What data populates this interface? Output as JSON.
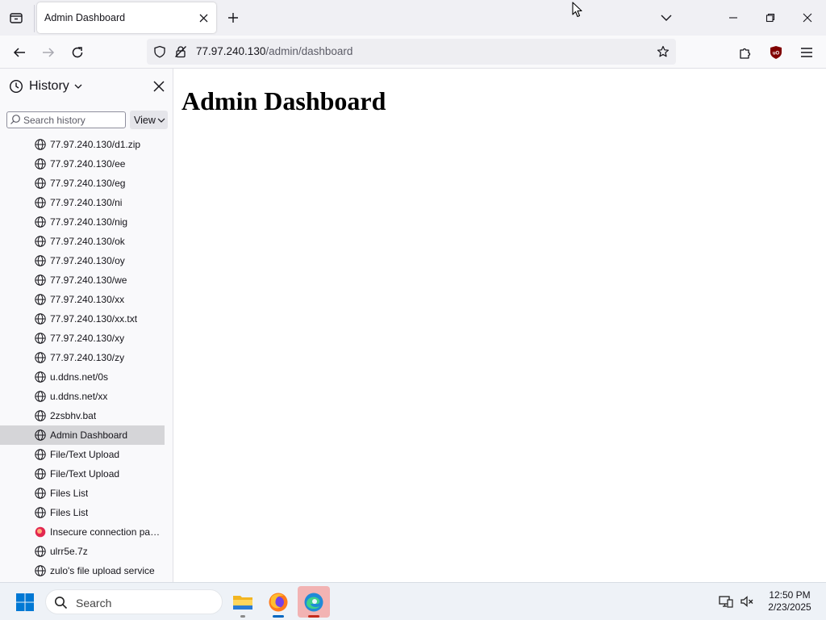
{
  "browser": {
    "tab": {
      "title": "Admin Dashboard"
    },
    "url": {
      "host": "77.97.240.130",
      "path": "/admin/dashboard"
    }
  },
  "sidebar": {
    "title": "History",
    "search_placeholder": "Search history",
    "view_label": "View",
    "items": [
      {
        "label": "77.97.240.130/d1.zip",
        "icon": "globe-icon",
        "selected": false
      },
      {
        "label": "77.97.240.130/ee",
        "icon": "globe-icon",
        "selected": false
      },
      {
        "label": "77.97.240.130/eg",
        "icon": "globe-icon",
        "selected": false
      },
      {
        "label": "77.97.240.130/ni",
        "icon": "globe-icon",
        "selected": false
      },
      {
        "label": "77.97.240.130/nig",
        "icon": "globe-icon",
        "selected": false
      },
      {
        "label": "77.97.240.130/ok",
        "icon": "globe-icon",
        "selected": false
      },
      {
        "label": "77.97.240.130/oy",
        "icon": "globe-icon",
        "selected": false
      },
      {
        "label": "77.97.240.130/we",
        "icon": "globe-icon",
        "selected": false
      },
      {
        "label": "77.97.240.130/xx",
        "icon": "globe-icon",
        "selected": false
      },
      {
        "label": "77.97.240.130/xx.txt",
        "icon": "globe-icon",
        "selected": false
      },
      {
        "label": "77.97.240.130/xy",
        "icon": "globe-icon",
        "selected": false
      },
      {
        "label": "77.97.240.130/zy",
        "icon": "globe-icon",
        "selected": false
      },
      {
        "label": "u.ddns.net/0s",
        "icon": "globe-icon",
        "selected": false
      },
      {
        "label": "u.ddns.net/xx",
        "icon": "globe-icon",
        "selected": false
      },
      {
        "label": "2zsbhv.bat",
        "icon": "globe-icon",
        "selected": false
      },
      {
        "label": "Admin Dashboard",
        "icon": "globe-icon",
        "selected": true
      },
      {
        "label": "File/Text Upload",
        "icon": "globe-icon",
        "selected": false
      },
      {
        "label": "File/Text Upload",
        "icon": "globe-icon",
        "selected": false
      },
      {
        "label": "Files List",
        "icon": "globe-icon",
        "selected": false
      },
      {
        "label": "Files List",
        "icon": "globe-icon",
        "selected": false
      },
      {
        "label": "Insecure connection pass...",
        "icon": "warning-icon",
        "selected": false
      },
      {
        "label": "ulrr5e.7z",
        "icon": "globe-icon",
        "selected": false
      },
      {
        "label": "zulo's file upload service",
        "icon": "globe-icon",
        "selected": false
      }
    ]
  },
  "page": {
    "heading": "Admin Dashboard"
  },
  "taskbar": {
    "search_label": "Search",
    "time": "12:50 PM",
    "date": "2/23/2025"
  },
  "colors": {
    "selected_row": "#d5d5d8",
    "ublock": "#800000",
    "active_app": "#f2b3b3"
  }
}
